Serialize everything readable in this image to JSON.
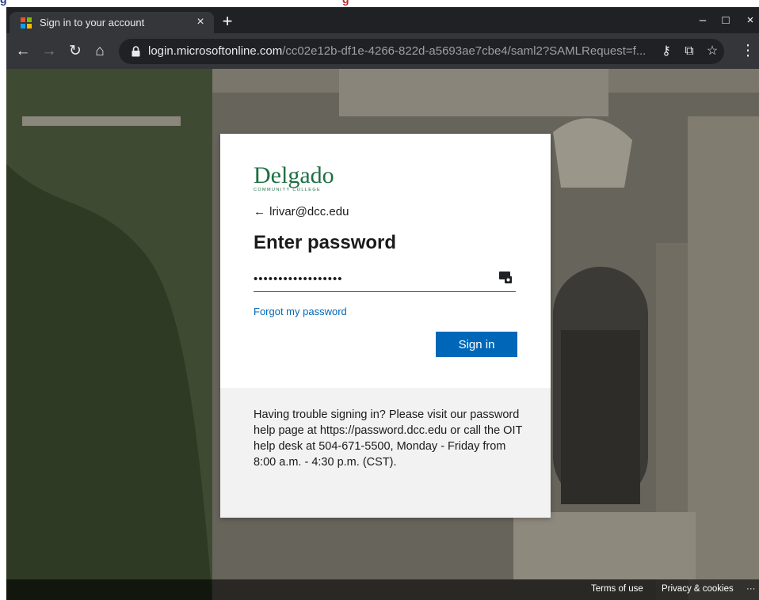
{
  "cropped_header": {
    "left_text": "g",
    "right_text": "g"
  },
  "tab": {
    "title": "Sign in to your account",
    "close_glyph": "×",
    "favicon": "microsoft-logo-icon"
  },
  "window_controls": {
    "new_tab": "+",
    "minimize": "–",
    "maximize": "□",
    "close": "×"
  },
  "address_bar": {
    "host": "login.microsoftonline.com",
    "path": "/cc02e12b-df1e-4266-822d-a5693ae7cbe4/saml2?SAMLRequest=f..."
  },
  "signin_card": {
    "logo_text": "Delgado",
    "logo_subtext": "COMMUNITY COLLEGE",
    "back_arrow": "←",
    "account_email": "lrivar@dcc.edu",
    "heading": "Enter password",
    "password_value": "••••••••••••••••••",
    "forgot_link": "Forgot my password",
    "signin_button": "Sign in",
    "help_text": "Having trouble signing in? Please visit our password help page at https://password.dcc.edu or call the OIT help desk at 504-671-5500, Monday - Friday from 8:00 a.m. - 4:30 p.m. (CST)."
  },
  "footer": {
    "terms": "Terms of use",
    "privacy": "Privacy & cookies",
    "more": "···"
  },
  "colors": {
    "accent": "#0067b8",
    "logo_green": "#1f6f43",
    "browser_dark": "#202124",
    "browser_toolbar": "#35363a"
  }
}
